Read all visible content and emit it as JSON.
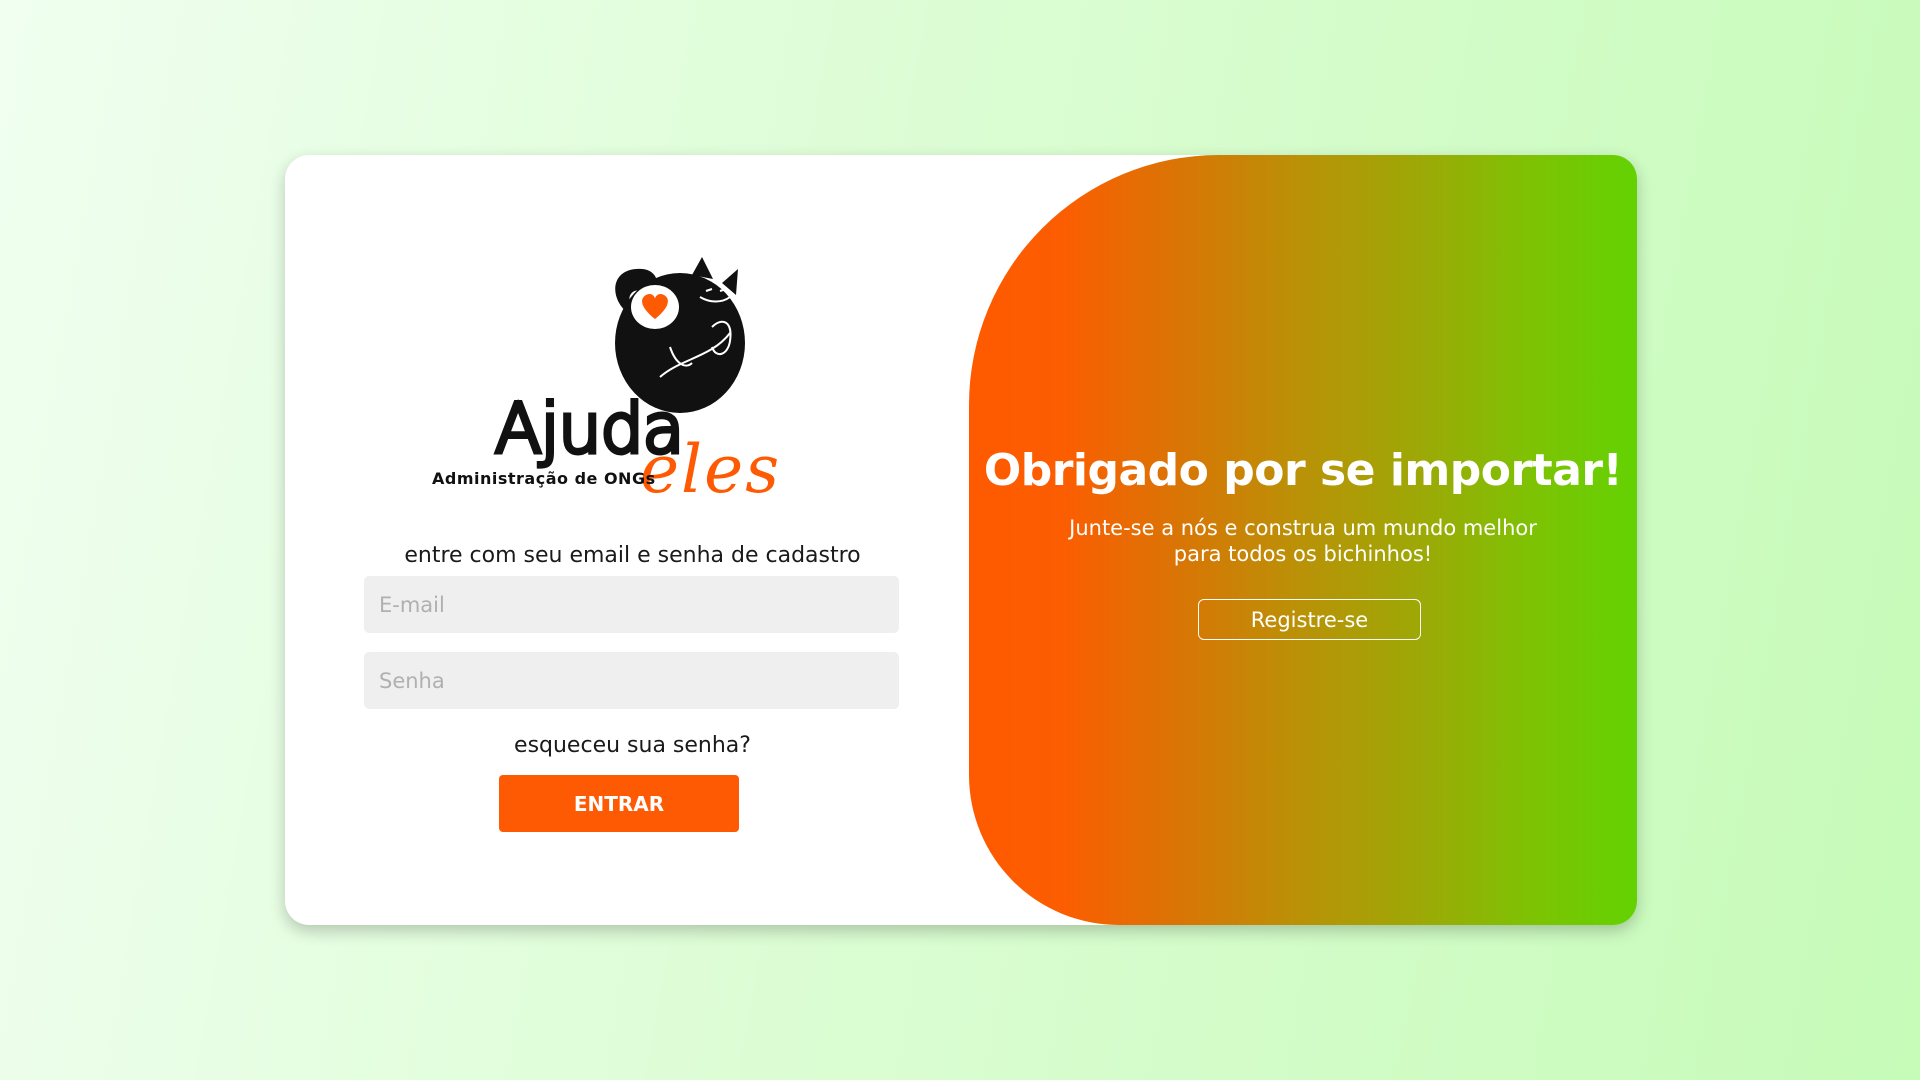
{
  "logo": {
    "brand_main": "Ajuda",
    "brand_script": "eles",
    "tagline": "Administração de ONGs"
  },
  "login": {
    "instructions": "entre com seu email e senha de cadastro",
    "email_placeholder": "E-mail",
    "password_placeholder": "Senha",
    "forgot_password": "esqueceu sua senha?",
    "submit_label": "ENTRAR"
  },
  "promo": {
    "title": "Obrigado por se importar!",
    "subtitle_line1": "Junte-se a nós e construa um mundo melhor",
    "subtitle_line2": "para todos os bichinhos!",
    "register_label": "Registre-se"
  },
  "colors": {
    "accent_orange": "#fe5a03",
    "accent_green": "#63d202",
    "background_green": "#c6fbb8",
    "input_background": "#efefef"
  }
}
